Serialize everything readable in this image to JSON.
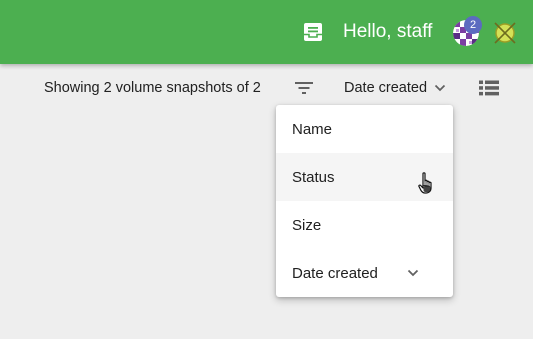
{
  "header": {
    "greeting": "Hello, staff",
    "notification_count": "2",
    "icons": {
      "inbox": "inbox-icon",
      "avatar": "user-avatar",
      "status": "status-icon"
    },
    "colors": {
      "bar": "#4caf50",
      "badge": "#5c6bc0"
    }
  },
  "toolbar": {
    "count_text": "Showing 2 volume snapshots of 2",
    "sort_label": "Date created",
    "icons": {
      "filter": "filter-icon",
      "sort_toggle": "chevron-down-icon",
      "view": "list-view-icon"
    }
  },
  "sort_menu": {
    "items": [
      {
        "label": "Name"
      },
      {
        "label": "Status",
        "hovered": true
      },
      {
        "label": "Size"
      },
      {
        "label": "Date created",
        "selected": true
      }
    ]
  }
}
